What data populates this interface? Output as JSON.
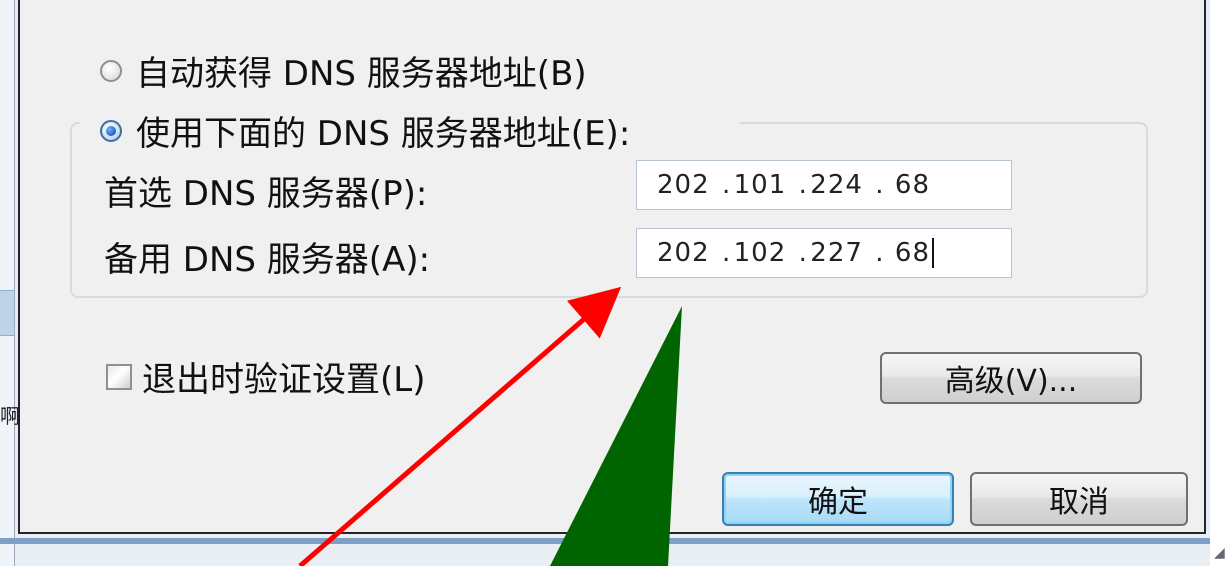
{
  "dns_dialog": {
    "auto_dns_label": "自动获得 DNS 服务器地址(B)",
    "manual_dns_label": "使用下面的 DNS 服务器地址(E):",
    "preferred_label": "首选 DNS 服务器(P):",
    "alternate_label": "备用 DNS 服务器(A):",
    "preferred_ip": [
      "202",
      "101",
      "224",
      "68"
    ],
    "alternate_ip": [
      "202",
      "102",
      "227",
      "68"
    ],
    "ip_separator": ".",
    "validate_label": "退出时验证设置(L)",
    "advanced_button": "高级(V)...",
    "ok_button": "确定",
    "cancel_button": "取消",
    "auto_dns_selected": false,
    "manual_dns_selected": true,
    "validate_checked": false
  },
  "left_edge_glyph": "啊",
  "colors": {
    "dialog_bg": "#f0f0f0",
    "accent_blue": "#3c7fb1",
    "arrow_red": "#ff0000",
    "pointer_green": "#006400"
  }
}
